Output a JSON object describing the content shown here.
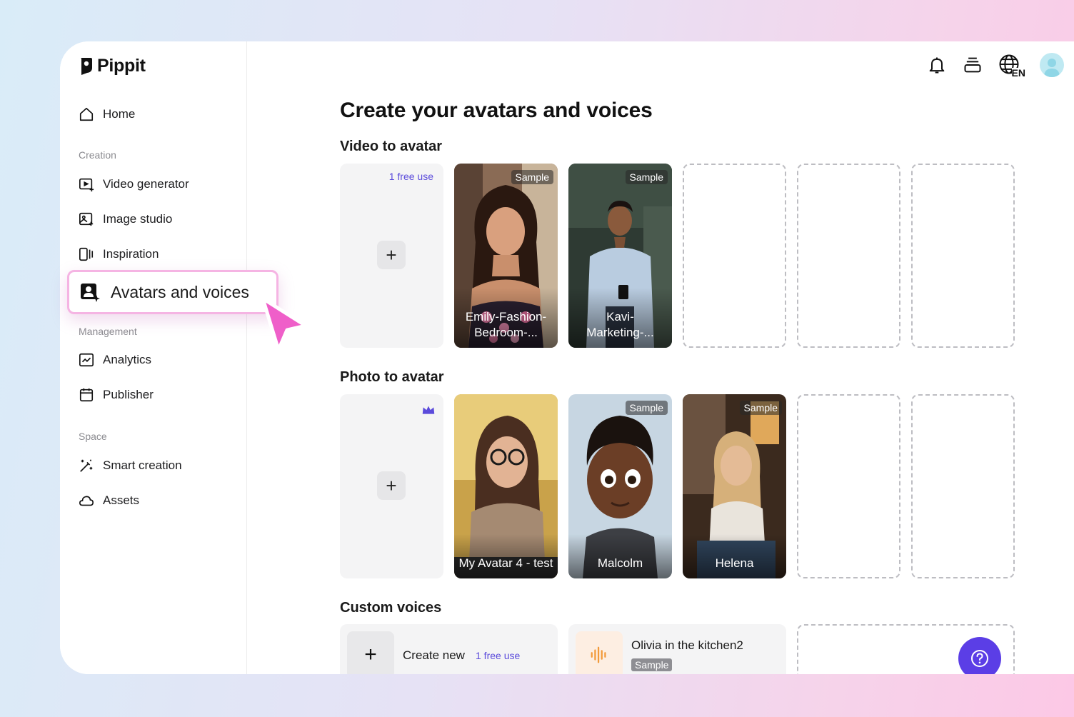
{
  "brand": {
    "name": "Pippit"
  },
  "sidebar": {
    "home": "Home",
    "sections": {
      "creation": "Creation",
      "management": "Management",
      "space": "Space"
    },
    "creation_items": [
      "Video generator",
      "Image studio",
      "Inspiration"
    ],
    "active_item": "Avatars and voices",
    "management_items": [
      "Analytics",
      "Publisher"
    ],
    "space_items": [
      "Smart creation",
      "Assets"
    ]
  },
  "topbar": {
    "language": "EN"
  },
  "main": {
    "title": "Create your avatars and voices",
    "video_to_avatar": {
      "title": "Video to avatar",
      "free_use": "1 free use",
      "cards": [
        {
          "badge": "Sample",
          "label": "Emily-Fashion-Bedroom-..."
        },
        {
          "badge": "Sample",
          "label": "Kavi-Marketing-..."
        }
      ]
    },
    "photo_to_avatar": {
      "title": "Photo to avatar",
      "cards": [
        {
          "badge": "",
          "label": "My Avatar 4 - test"
        },
        {
          "badge": "Sample",
          "label": "Malcolm"
        },
        {
          "badge": "Sample",
          "label": "Helena"
        }
      ]
    },
    "custom_voices": {
      "title": "Custom voices",
      "create_label": "Create new",
      "free_use": "1 free use",
      "voice": {
        "name": "Olivia in the kitchen2",
        "badge": "Sample"
      }
    }
  },
  "colors": {
    "accent": "#5b3ee6",
    "free_use_text": "#5b4bdb",
    "highlight_border": "#f5b4e3",
    "cursor": "#ef5fc9"
  }
}
